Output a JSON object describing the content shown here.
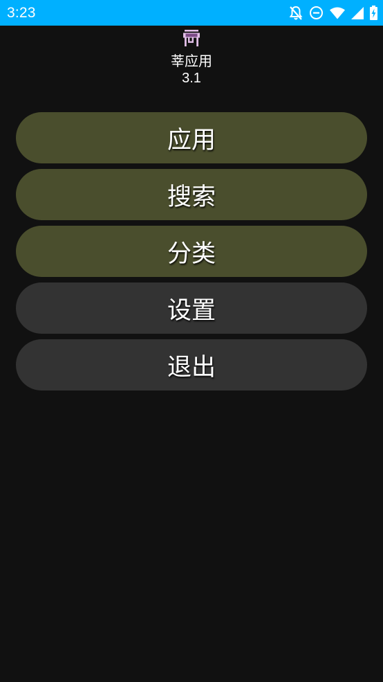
{
  "status_bar": {
    "time": "3:23",
    "background": "#00b0ff",
    "icons": [
      "notifications-off-icon",
      "do-not-disturb-icon",
      "wifi-icon",
      "signal-icon",
      "battery-charging-icon"
    ]
  },
  "app": {
    "name": "莘应用",
    "version": "3.1",
    "icon": "store-icon",
    "icon_color": "#e1bee7"
  },
  "menu": {
    "items": [
      {
        "label": "应用",
        "color": "#4a4e2d"
      },
      {
        "label": "搜索",
        "color": "#4a4e2d"
      },
      {
        "label": "分类",
        "color": "#4a4e2d"
      },
      {
        "label": "设置",
        "color": "#333333"
      },
      {
        "label": "退出",
        "color": "#333333"
      }
    ]
  },
  "colors": {
    "background": "#111111",
    "text": "#ffffff"
  }
}
